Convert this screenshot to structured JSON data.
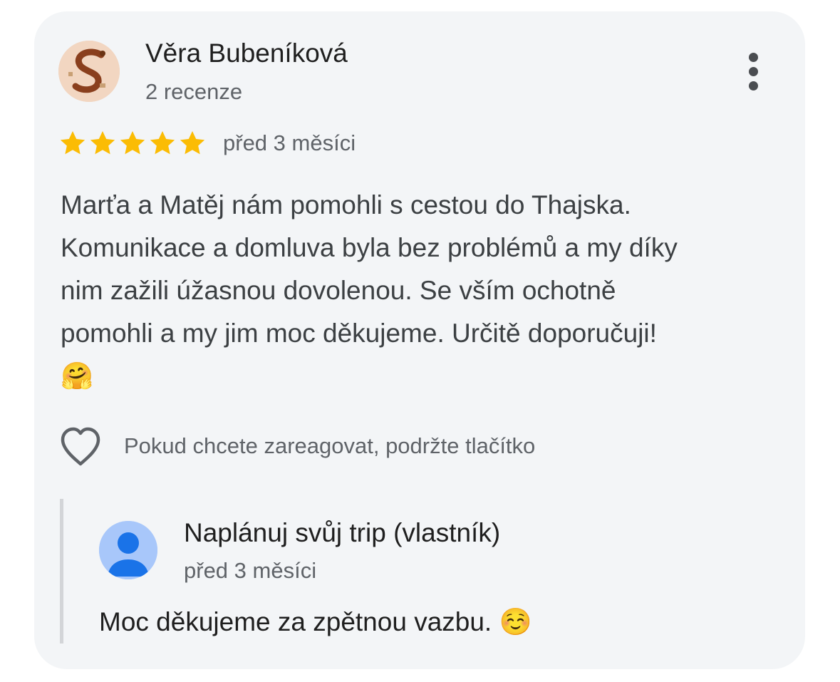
{
  "review": {
    "author_name": "Věra Bubeníková",
    "author_review_count": "2 recenze",
    "rating": 5,
    "rating_max": 5,
    "date": "před 3 měsíci",
    "text": "Marťa a Matěj nám pomohli s cestou do Thajska.\nKomunikace a domluva byla bez problémů a my díky\nnim zažili úžasnou dovolenou. Se vším ochotně\npomohli a my jim moc děkujeme. Určitě doporučuji!\n🤗",
    "more_menu_icon": "more-vertical-icon",
    "star_color": "#fbbc04"
  },
  "reaction": {
    "icon": "heart-outline-icon",
    "hint": "Pokud chcete zareagovat, podržte tlačítko"
  },
  "owner_reply": {
    "author_name": "Naplánuj svůj trip (vlastník)",
    "date": "před 3 měsíci",
    "text": "Moc děkujeme za zpětnou vazbu. ☺️",
    "avatar_icon": "person-icon",
    "avatar_color": "#a8c7fa",
    "avatar_figure_color": "#1a73e8"
  }
}
